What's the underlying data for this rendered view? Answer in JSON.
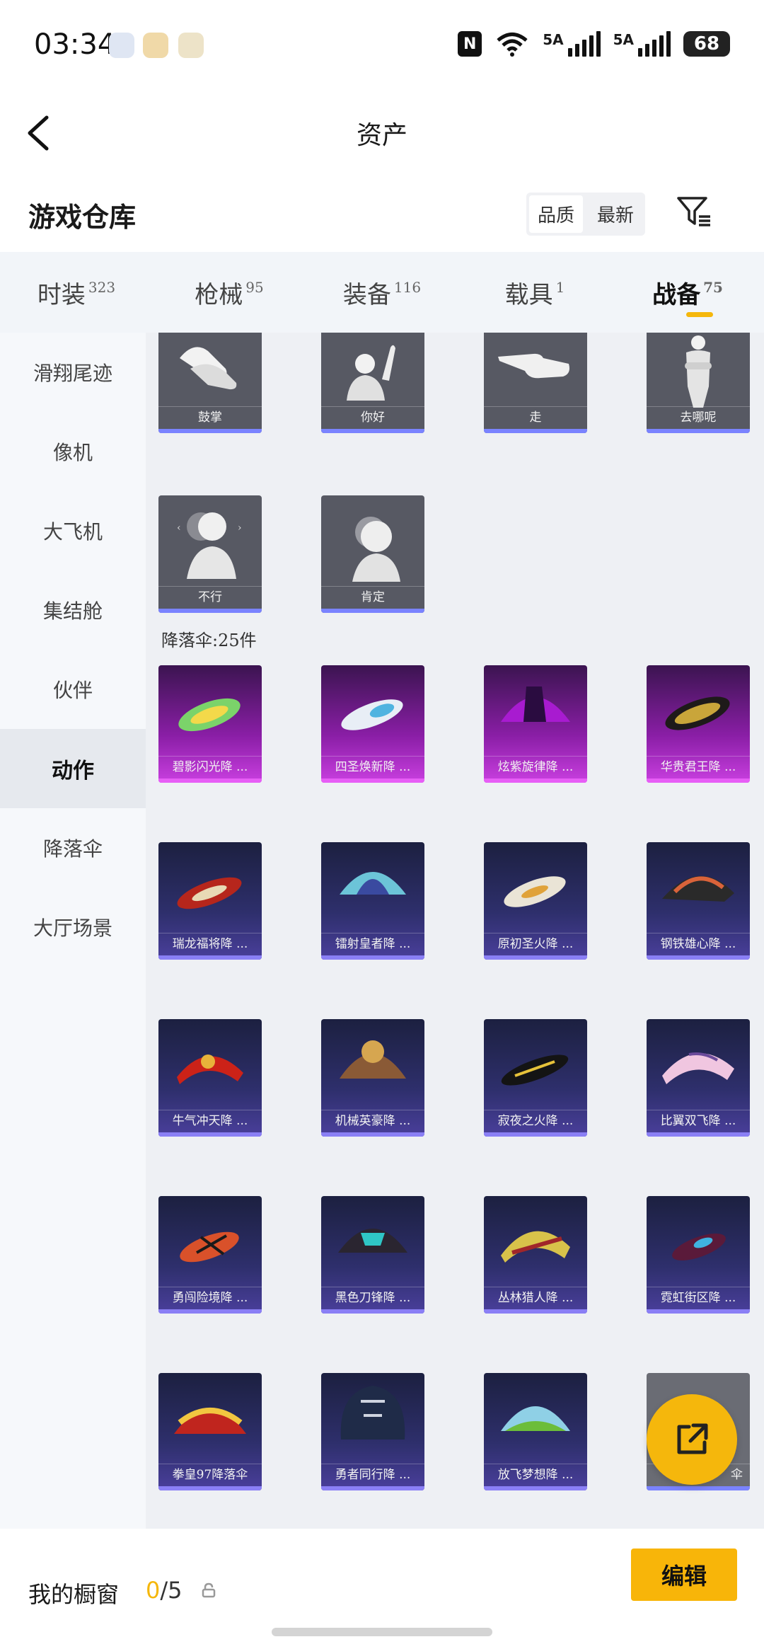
{
  "status_bar": {
    "time": "03:34",
    "nfc": "N",
    "net1": "6",
    "net2": "5A",
    "net3": "5A",
    "battery": "68"
  },
  "header": {
    "title": "资产"
  },
  "warehouse": {
    "title": "游戏仓库",
    "sort_quality": "品质",
    "sort_newest": "最新"
  },
  "tabs": [
    {
      "label": "时装",
      "count": "323"
    },
    {
      "label": "枪械",
      "count": "95"
    },
    {
      "label": "装备",
      "count": "116"
    },
    {
      "label": "载具",
      "count": "1"
    },
    {
      "label": "战备",
      "count": "75"
    }
  ],
  "sidebar": [
    "滑翔尾迹",
    "像机",
    "大飞机",
    "集结舱",
    "伙伴",
    "动作",
    "降落伞",
    "大厅场景"
  ],
  "actions": [
    "鼓掌",
    "你好",
    "走",
    "去哪呢",
    "不行",
    "肯定"
  ],
  "parachute_section": "降落伞:25件",
  "parachutes": [
    "碧影闪光降 ...",
    "四圣焕新降 ...",
    "炫紫旋律降 ...",
    "华贵君王降 ...",
    "瑞龙福将降 ...",
    "镭射皇者降 ...",
    "原初圣火降 ...",
    "钢铁雄心降 ...",
    "牛气冲天降 ...",
    "机械英豪降 ...",
    "寂夜之火降 ...",
    "比翼双飞降 ...",
    "勇闯险境降 ...",
    "黑色刀锋降 ...",
    "丛林猎人降 ...",
    "霓虹街区降 ...",
    "拳皇97降落伞",
    "勇者同行降 ...",
    "放飞梦想降 ...",
    "伞"
  ],
  "bottom": {
    "label": "我的橱窗",
    "used": "0",
    "total": "/5",
    "edit": "编辑"
  },
  "colors": {
    "accent": "#f5b70c",
    "purple_card": "#c93fe0",
    "blue_card": "#4a3f9c"
  }
}
